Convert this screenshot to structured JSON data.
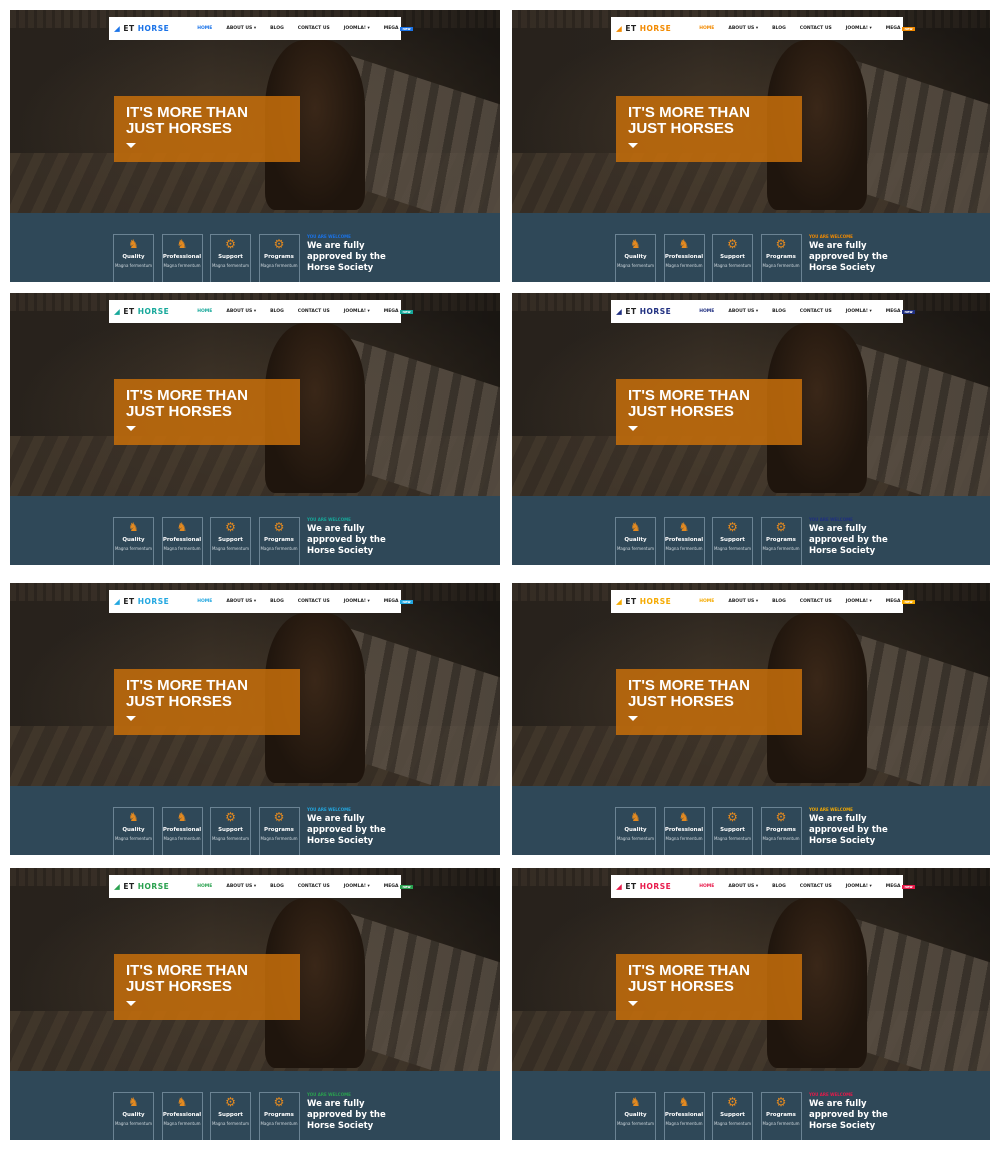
{
  "site": {
    "logo_prefix": "ET",
    "logo_name": "HORSE",
    "nav": [
      "HOME",
      "ABOUT US ▾",
      "BLOG",
      "CONTACT US",
      "JOOMLA! ▾",
      "MEGA"
    ],
    "badge": "new",
    "hero_title": "IT'S MORE THAN JUST HORSES",
    "features": [
      {
        "icon": "horse-icon",
        "title": "Quality",
        "sub": "Magna fermentum"
      },
      {
        "icon": "horse-icon",
        "title": "Professional",
        "sub": "Magna fermentum"
      },
      {
        "icon": "horseshoe-icon",
        "title": "Support",
        "sub": "Magna fermentum"
      },
      {
        "icon": "horseshoe-icon",
        "title": "Programs",
        "sub": "Magna fermentum"
      }
    ],
    "welcome": "YOU ARE WELCOME",
    "approved": "We are fully approved by the Horse Society"
  },
  "variants": [
    {
      "accent": "#1a73e8"
    },
    {
      "accent": "#f28a00"
    },
    {
      "accent": "#16a89a"
    },
    {
      "accent": "#1f2f80"
    },
    {
      "accent": "#22a7e0"
    },
    {
      "accent": "#f5aa00"
    },
    {
      "accent": "#2aa14f"
    },
    {
      "accent": "#e8194a"
    }
  ]
}
